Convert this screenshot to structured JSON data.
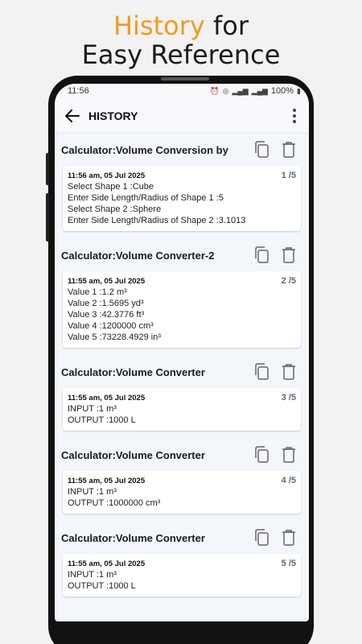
{
  "promo": {
    "line1_accent": "History",
    "line1_rest": " for",
    "line2": "Easy Reference"
  },
  "status": {
    "time": "11:56",
    "battery": "100%"
  },
  "appbar": {
    "title": "HISTORY"
  },
  "entries": [
    {
      "title": "Calculator:Volume Conversion by",
      "time": "11:56 am, 05 Jul 2025",
      "count": "1 /5",
      "lines": [
        "Select Shape 1 :Cube",
        "Enter Side Length/Radius of Shape 1 :5",
        "Select Shape 2 :Sphere",
        "Enter Side Length/Radius of Shape 2 :3.1013"
      ]
    },
    {
      "title": "Calculator:Volume Converter-2",
      "time": "11:55 am, 05 Jul 2025",
      "count": "2 /5",
      "lines": [
        "Value 1 :1.2 m³",
        "Value 2 :1.5695 yd³",
        "Value 3 :42.3776 ft³",
        "Value 4 :1200000 cm³",
        "Value 5 :73228.4929 in³"
      ]
    },
    {
      "title": "Calculator:Volume Converter",
      "time": "11:55 am, 05 Jul 2025",
      "count": "3 /5",
      "lines": [
        "INPUT :1 m³",
        "OUTPUT :1000 L"
      ]
    },
    {
      "title": "Calculator:Volume Converter",
      "time": "11:55 am, 05 Jul 2025",
      "count": "4 /5",
      "lines": [
        "INPUT :1 m³",
        "OUTPUT :1000000 cm³"
      ]
    },
    {
      "title": "Calculator:Volume Converter",
      "time": "11:55 am, 05 Jul 2025",
      "count": "5 /5",
      "lines": [
        "INPUT :1 m³",
        "OUTPUT :1000 L"
      ]
    }
  ],
  "icons": {
    "copy": "copy-icon",
    "delete": "trash-icon",
    "back": "back-arrow-icon",
    "menu": "more-vertical-icon"
  },
  "colors": {
    "accent": "#f39a1e",
    "screen_bg": "#f3f7fb"
  }
}
